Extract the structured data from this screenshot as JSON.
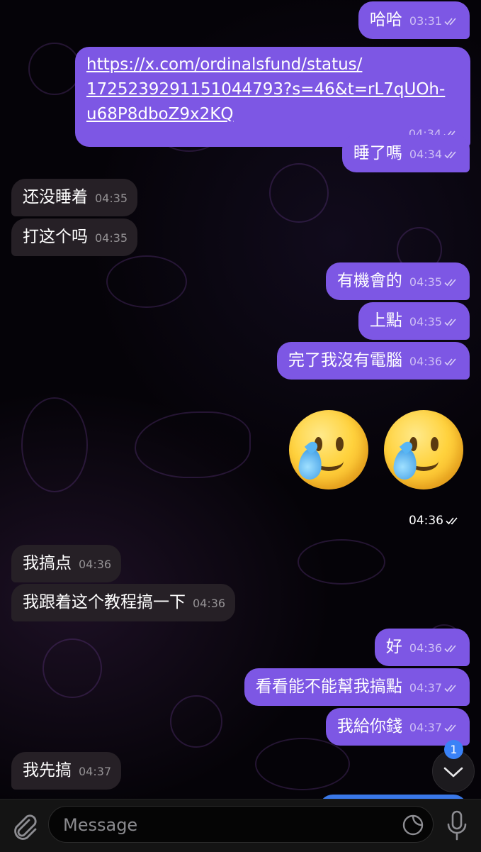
{
  "messages": [
    {
      "text": "哈哈",
      "time": "03:31"
    },
    {
      "link": "https://x.com/ordinalsfund/status/1725239291151044793?s=46&t=rL7qUOh-u68P8dboZ9x2KQ",
      "link_line1": "https://x.com/ordinalsfund/status/",
      "link_line2": "1725239291151044793?s=46&t=rL7qUOh-",
      "link_line3": "u68P8dboZ9x2KQ",
      "time": "04:34"
    },
    {
      "text": "睡了嗎",
      "time": "04:34"
    },
    {
      "text": "还没睡着",
      "time": "04:35"
    },
    {
      "text": "打这个吗",
      "time": "04:35"
    },
    {
      "text": "有機會的",
      "time": "04:35"
    },
    {
      "text": "上點",
      "time": "04:35"
    },
    {
      "text": "完了我沒有電腦",
      "time": "04:36"
    },
    {
      "emoji": "🥲🥲",
      "time": "04:36"
    },
    {
      "text": "我搞点",
      "time": "04:36"
    },
    {
      "text": "我跟着这个教程搞一下",
      "time": "04:36"
    },
    {
      "text": "好",
      "time": "04:36"
    },
    {
      "text": "看看能不能幫我搞點",
      "time": "04:37"
    },
    {
      "text": "我給你錢",
      "time": "04:37"
    },
    {
      "text": "我先搞",
      "time": "04:37"
    }
  ],
  "scroll_badge": "1",
  "composer": {
    "placeholder": "Message"
  },
  "icons": {
    "attach": "paperclip-icon",
    "sticker": "sticker-icon",
    "mic": "microphone-icon",
    "scroll": "chevron-down-icon",
    "read": "double-check-icon"
  },
  "colors": {
    "outgoing_bubble": "#7d57e4",
    "incoming_bubble": "#262026",
    "badge": "#3a82f7",
    "background": "#050308"
  }
}
